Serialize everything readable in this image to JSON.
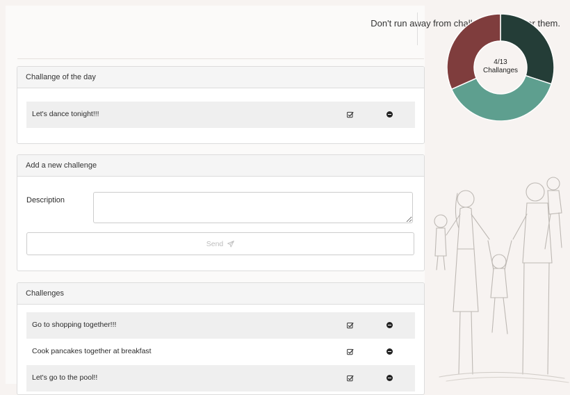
{
  "quote": "Don't run away from challenges, run over them.",
  "challenge_of_day": {
    "title": "Challange of the day",
    "items": [
      {
        "text": "Let's dance tonight!!!"
      }
    ]
  },
  "add_challenge": {
    "title": "Add a new challenge",
    "description_label": "Description",
    "description_value": "",
    "send_label": "Send"
  },
  "challenges": {
    "title": "Challenges",
    "items": [
      {
        "text": "Go to shopping together!!!"
      },
      {
        "text": "Cook pancakes together at breakfast"
      },
      {
        "text": "Let's go to the pool!!"
      }
    ]
  },
  "progress": {
    "fraction_label": "4/13",
    "label": "Challanges",
    "completed": 4,
    "total": 13
  },
  "chart_colors": {
    "dark_green": "#243d37",
    "teal": "#5e9f8f",
    "maroon": "#7f3d3d"
  },
  "icons": {
    "check": "check-square-icon",
    "remove": "minus-circle-icon",
    "send": "paper-plane-icon"
  }
}
